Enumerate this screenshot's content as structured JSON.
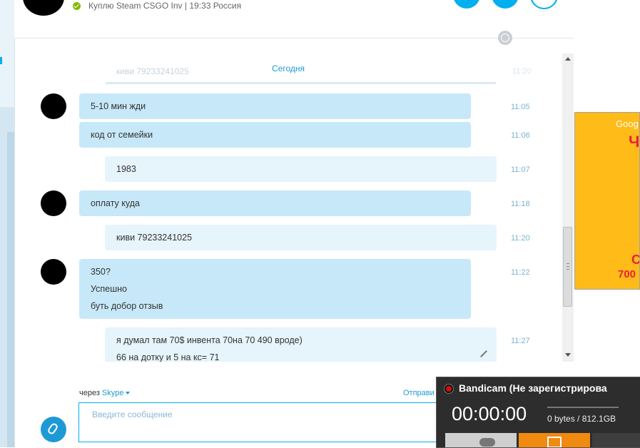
{
  "header": {
    "mood": "Куплю Steam CSGO Inv",
    "separator": "|",
    "local_time": "19:33",
    "location": "Россия",
    "status": "online",
    "buttons": [
      "video-call",
      "audio-call",
      "add-participants"
    ]
  },
  "conversation": {
    "date_label": "Сегодня",
    "ghost_text": "киви 79233241025",
    "ghost_time": "11:20",
    "messages": [
      {
        "side": "in",
        "lines": [
          "5-10 мин жди"
        ],
        "time": "11:05",
        "avatar": true
      },
      {
        "side": "in",
        "lines": [
          "код от семейки"
        ],
        "time": "11:06",
        "avatar": false
      },
      {
        "side": "out",
        "lines": [
          "1983"
        ],
        "time": "11:07",
        "avatar": false
      },
      {
        "side": "in",
        "lines": [
          "оплату куда"
        ],
        "time": "11:18",
        "avatar": true
      },
      {
        "side": "out",
        "lines": [
          "киви 79233241025"
        ],
        "time": "11:20",
        "avatar": false
      },
      {
        "side": "in",
        "lines": [
          "350?",
          "Успешно",
          "буть добор отзыв"
        ],
        "time": "11:22",
        "avatar": true
      },
      {
        "side": "out",
        "lines": [
          "я думал там 70$ инвента 70на 70 490 вроде)",
          "66 на дотку и 5 на кс= 71"
        ],
        "time": "11:27",
        "avatar": false
      }
    ]
  },
  "compose": {
    "via_label": "через",
    "via_service": "Skype",
    "send_label": "Отправи",
    "placeholder": "Введите сообщение"
  },
  "ad": {
    "line1": "Goog",
    "line2": "Ч",
    "line3": "С",
    "line4": "700"
  },
  "bandicam": {
    "title": "Bandicam (Не зарегистрирова",
    "timer": "00:00:00",
    "size": "0 bytes / 812.1GB"
  },
  "colors": {
    "accent": "#00aff0",
    "incoming_bubble": "#c7e8f8",
    "outgoing_bubble": "#e6f4fb",
    "ad_background": "#ffbb17",
    "ad_text": "#e8213a"
  }
}
